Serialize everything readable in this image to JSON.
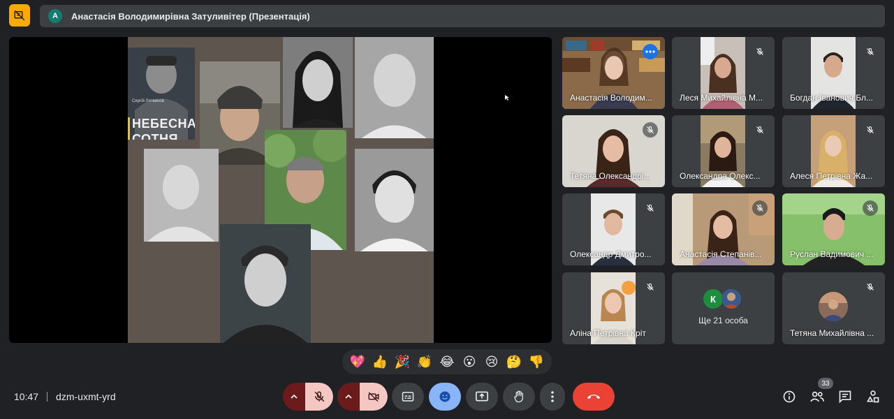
{
  "topbar": {
    "presenter_initial": "А",
    "presenter_title": "Анастасія Володимирівна Затуливітер (Презентація)"
  },
  "slide": {
    "book_author": "Сергій Литвинов",
    "book_title_line1": "НЕБЕСНА",
    "book_title_line2": "СОТНЯ"
  },
  "participants": [
    {
      "name": "Анастасія Володим...",
      "muted": false,
      "active": true
    },
    {
      "name": "Леся Михайлівна М...",
      "muted": true
    },
    {
      "name": "Богдан Іванович Бл...",
      "muted": true
    },
    {
      "name": "Тетяна Олександрі...",
      "muted": true
    },
    {
      "name": "Олександра Олекс...",
      "muted": true
    },
    {
      "name": "Алеся Петрівна Жа...",
      "muted": true
    },
    {
      "name": "Олександр Дмитро...",
      "muted": true
    },
    {
      "name": "Анастасія Степанів...",
      "muted": true
    },
    {
      "name": "Руслан Вадимович ...",
      "muted": true
    },
    {
      "name": "Аліна Петрівна Кріт",
      "muted": true
    },
    {
      "name": "Тетяна Михайлівна ...",
      "muted": true
    }
  ],
  "others_tile": {
    "label": "Ще 21 особа",
    "avatar_initial": "К"
  },
  "reactions": [
    "💖",
    "👍",
    "🎉",
    "👏",
    "😂",
    "😮",
    "😢",
    "🤔",
    "👎"
  ],
  "meeting": {
    "time": "10:47",
    "code": "dzm-uxmt-yrd"
  },
  "people_count": "33",
  "colors": {
    "accent_blue": "#8ab4f8",
    "hangup_red": "#ea4335",
    "muted_bg": "#f4c7c3",
    "logo_yellow": "#f9ab00",
    "surface": "#3c4043",
    "background": "#202124"
  }
}
